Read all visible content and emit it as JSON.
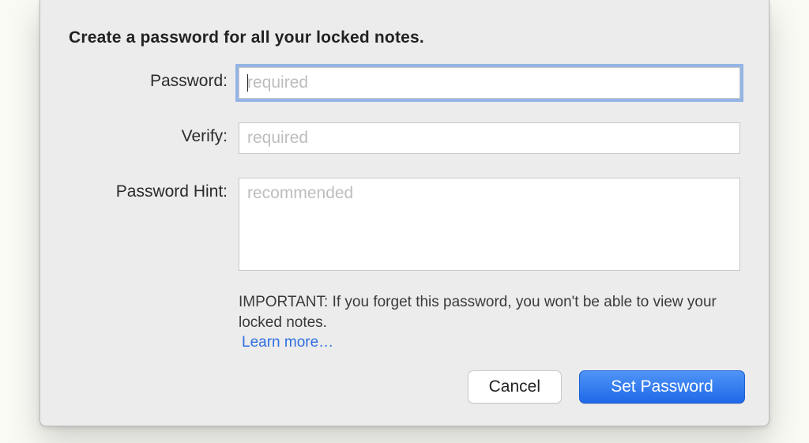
{
  "title": "Create a password for all your locked notes.",
  "fields": {
    "password": {
      "label": "Password:",
      "placeholder": "required",
      "value": ""
    },
    "verify": {
      "label": "Verify:",
      "placeholder": "required",
      "value": ""
    },
    "hint": {
      "label": "Password Hint:",
      "placeholder": "recommended",
      "value": ""
    }
  },
  "important": {
    "text": "IMPORTANT: If you forget this password, you won't be able to view your locked notes.",
    "learn_more": "Learn more…"
  },
  "buttons": {
    "cancel": "Cancel",
    "set_password": "Set Password"
  }
}
